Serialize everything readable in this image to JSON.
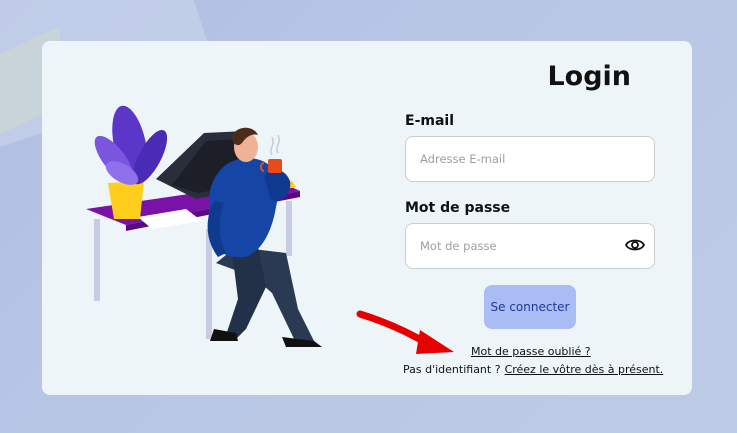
{
  "login": {
    "title": "Login",
    "email_label": "E-mail",
    "email_placeholder": "Adresse E-mail",
    "email_value": "",
    "password_label": "Mot de passe",
    "password_placeholder": "Mot de passe",
    "password_value": "",
    "submit_label": "Se connecter",
    "forgot_label": "Mot de passe oublié ?",
    "no_account_text": "Pas d'identifiant ?",
    "signup_label": "Créez le vôtre dès à présent."
  },
  "icons": {
    "password_toggle": "eye-icon",
    "annotation": "red-arrow-annotation"
  },
  "colors": {
    "button_bg": "#a9bdf4",
    "button_text": "#1d3a9a",
    "card_bg": "#edf5f8",
    "annotation": "#e60000"
  }
}
